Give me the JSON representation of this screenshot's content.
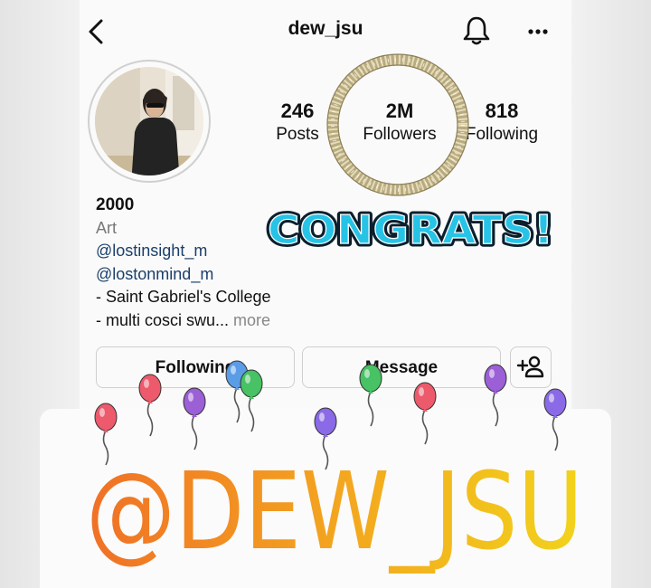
{
  "header": {
    "username": "dew_jsu",
    "icons": [
      "back-icon",
      "bell-icon",
      "more-icon"
    ]
  },
  "stats": {
    "posts_count": "246",
    "posts_label": "Posts",
    "followers_count": "2M",
    "followers_label": "Followers",
    "following_count": "818",
    "following_label": "Following"
  },
  "bio": {
    "name": "2000",
    "category": "Art",
    "link1": "@lostinsight_m",
    "link2": "@lostonmind_m",
    "line1": "- Saint Gabriel's College",
    "line2": "- multi cosci swu...",
    "more": "more"
  },
  "buttons": {
    "following": "Following",
    "message": "Message",
    "add_friend_icon": "add-person-icon"
  },
  "overlay": {
    "congrats_text": "CONGRATS!",
    "handle_text": "@DEW_JSU",
    "colors": {
      "congrats_fill": "#27c3e6",
      "congrats_outline": "#0b1f2e",
      "handle_start": "#f07026",
      "handle_end": "#f2d31b",
      "glitter": "#cbbf96"
    }
  }
}
